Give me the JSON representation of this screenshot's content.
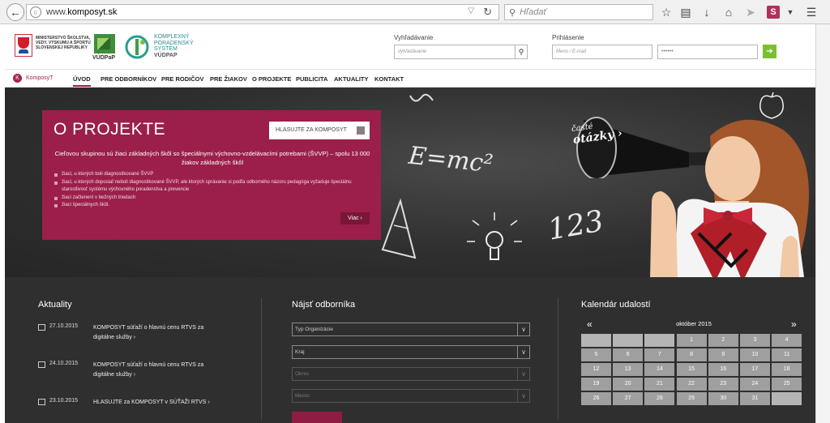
{
  "browser": {
    "url_host": "www.",
    "url_domain": "komposyt.sk",
    "search_placeholder": "Hľadať",
    "s_icon": "S"
  },
  "header": {
    "ministry_text": "Ministerstvo školstva, vedy, výskumu a športu Slovenskej republiky",
    "vudpp": "VÚDPaP",
    "kps_lines": [
      "Komplexný",
      "poradenský",
      "systém"
    ],
    "kps_strong": "VÚDPaP",
    "search_label": "Vyhľadávanie",
    "search_placeholder": "vyhľadávanie",
    "login_label": "Prihlásenie",
    "login_name_placeholder": "Meno / E-mail",
    "login_pass_value": "••••••"
  },
  "nav": {
    "brand": "KomposyT",
    "items": [
      "ÚVOD",
      "PRE ODBORNÍKOV",
      "PRE RODIČOV",
      "PRE ŽIAKOV",
      "O PROJEKTE",
      "PUBLICITA",
      "AKTUALITY",
      "KONTAKT"
    ]
  },
  "hero": {
    "chalk_formula": "E=mc²",
    "chalk_numbers": "123",
    "faq_line1": "časté",
    "faq_line2": "otázky ›",
    "promo": {
      "title": "O PROJEKTE",
      "vote_button": "HLASUJTE ZA KOMPOSYT",
      "lead": "Cieľovou skupinou sú žiaci základných škôl so špeciálnymi výchovno-vzdelávacími potrebami (ŠVVP) – spolu 13 000 žiakov základných škôl",
      "bullets": [
        "žiaci, u ktorých boli diagnostikované ŠVVP",
        "žiaci, u ktorých doposiaľ neboli diagnostikované ŠVVP, ale ktorých správanie si podľa odborného názoru pedagóga vyžaduje špeciálnu starostlivosť systému výchovného poradenstva a prevencie",
        "žiaci začlenení v bežných triedach",
        "žiaci špeciálnych škôl."
      ],
      "more": "Viac ›"
    }
  },
  "news": {
    "title": "Aktuality",
    "items": [
      {
        "date": "27.10.2015",
        "text": "KOMPOSYT súťaží o hlavnú cenu RTVS za digitálne služby ›"
      },
      {
        "date": "24.10.2015",
        "text": "KOMPOSYT súťaží o hlavnú cenu RTVS za digitálne služby ›"
      },
      {
        "date": "23.10.2015",
        "text": "HLASUJTE za KOMPOSYT v SÚŤAŽI RTVS ›"
      }
    ]
  },
  "finder": {
    "title": "Nájsť odborníka",
    "selects": [
      "Typ Organizácie",
      "Kraj",
      "Okres",
      "Mesto"
    ]
  },
  "calendar": {
    "title": "Kalendár udalostí",
    "month": "október 2015",
    "prev": "«",
    "next": "»",
    "cells": [
      "",
      "",
      "",
      "1",
      "2",
      "3",
      "4",
      "5",
      "6",
      "7",
      "8",
      "9",
      "10",
      "11",
      "12",
      "13",
      "14",
      "15",
      "16",
      "17",
      "18",
      "19",
      "20",
      "21",
      "22",
      "23",
      "24",
      "25",
      "26",
      "27",
      "28",
      "29",
      "30",
      "31",
      ""
    ]
  }
}
